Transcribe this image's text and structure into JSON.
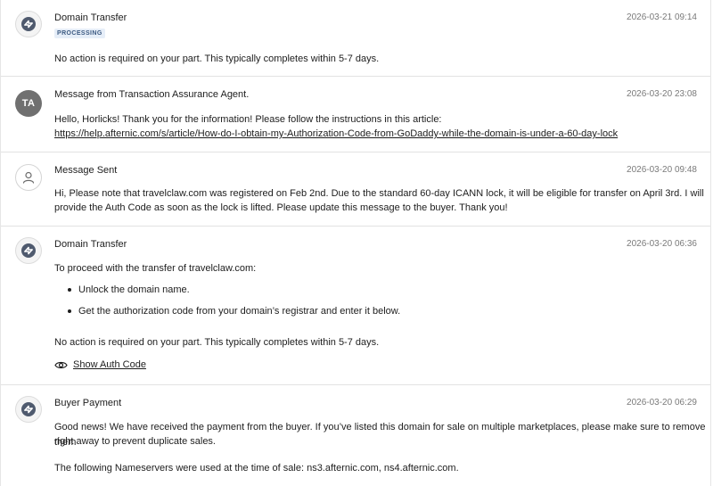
{
  "feed": {
    "items": [
      {
        "title": "Domain Transfer",
        "timestamp": "2026-03-21 09:14",
        "badge": "PROCESSING",
        "body": "No action is required on your part. This typically completes within 5-7 days."
      },
      {
        "title": "Message from Transaction Assurance Agent.",
        "timestamp": "2026-03-20 23:08",
        "avatar_initials": "TA",
        "body": "Hello, Horlicks! Thank you for the information! Please follow the instructions in this article:",
        "link": "https://help.afternic.com/s/article/How-do-I-obtain-my-Authorization-Code-from-GoDaddy-while-the-domain-is-under-a-60-day-lock"
      },
      {
        "title": "Message Sent",
        "timestamp": "2026-03-20 09:48",
        "body_line1": "Hi, Please note that travelclaw.com was registered on Feb 2nd. Due to the standard 60-day ICANN lock, it will be eligible for transfer on April 3rd. I will",
        "body_line2": "provide the Auth Code as soon as the lock is lifted. Please update this message to the buyer. Thank you!"
      },
      {
        "title": "Domain Transfer",
        "timestamp": "2026-03-20 06:36",
        "intro": "To proceed with the transfer of travelclaw.com:",
        "bullets": [
          "Unlock the domain name.",
          "Get the authorization code from your domain’s registrar and enter it below."
        ],
        "body": "No action is required on your part. This typically completes within 5-7 days.",
        "action_label": "Show Auth Code"
      },
      {
        "title": "Buyer Payment",
        "timestamp": "2026-03-20 06:29",
        "body_line1": "Good news! We have received the payment from the buyer. If you’ve listed this domain for sale on multiple marketplaces, please make sure to remove them",
        "body_line2": "right away to prevent duplicate sales.",
        "body_line3": "The following Nameservers were used at the time of sale: ns3.afternic.com, ns4.afternic.com."
      }
    ]
  },
  "icons": {
    "system_avatar": "afternic-logo-icon",
    "user_avatar": "user-icon",
    "auth_action": "eye-icon"
  }
}
